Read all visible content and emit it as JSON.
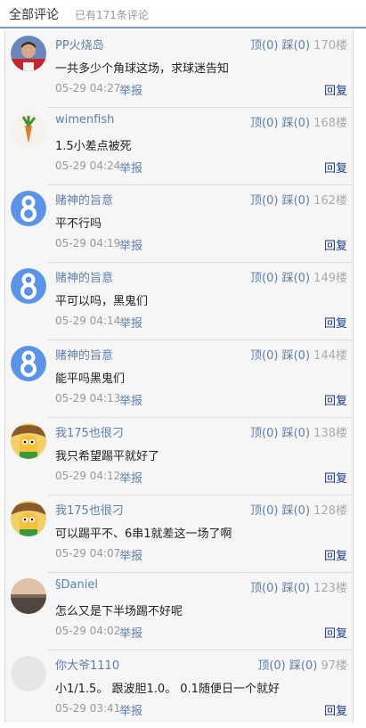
{
  "header": {
    "title": "全部评论",
    "count_text": "已有171条评论"
  },
  "comments": [
    {
      "user": "PP火烧岛",
      "up": "顶(0)",
      "down": "踩(0)",
      "floor": "170楼",
      "text": "一共多少个角球这场，求球迷告知",
      "time": "05-29 04:27",
      "report": "举报",
      "reply": "回复",
      "avatar_icon": "player-photo-avatar-icon"
    },
    {
      "user": "wimenfish",
      "up": "顶(0)",
      "down": "踩(0)",
      "floor": "168楼",
      "text": "1.5小差点被死",
      "time": "05-29 04:24",
      "report": "举报",
      "reply": "回复",
      "avatar_icon": "carrot-avatar-icon"
    },
    {
      "user": "赌神的旨意",
      "up": "顶(0)",
      "down": "踩(0)",
      "floor": "162楼",
      "text": "平不行吗",
      "time": "05-29 04:19",
      "report": "举报",
      "reply": "回复",
      "avatar_icon": "number-8-avatar-icon"
    },
    {
      "user": "赌神的旨意",
      "up": "顶(0)",
      "down": "踩(0)",
      "floor": "149楼",
      "text": "平可以吗，黑鬼们",
      "time": "05-29 04:14",
      "report": "举报",
      "reply": "回复",
      "avatar_icon": "number-8-avatar-icon"
    },
    {
      "user": "赌神的旨意",
      "up": "顶(0)",
      "down": "踩(0)",
      "floor": "144楼",
      "text": "能平吗黑鬼们",
      "time": "05-29 04:13",
      "report": "举报",
      "reply": "回复",
      "avatar_icon": "number-8-avatar-icon"
    },
    {
      "user": "我175也很刁",
      "up": "顶(0)",
      "down": "踩(0)",
      "floor": "138楼",
      "text": "我只希望踢平就好了",
      "time": "05-29 04:12",
      "report": "举报",
      "reply": "回复",
      "avatar_icon": "cartoon-avatar-icon"
    },
    {
      "user": "我175也很刁",
      "up": "顶(0)",
      "down": "踩(0)",
      "floor": "128楼",
      "text": "可以踢平不、6串1就差这一场了啊",
      "time": "05-29 04:07",
      "report": "举报",
      "reply": "回复",
      "avatar_icon": "cartoon-avatar-icon"
    },
    {
      "user": "§Daniel",
      "up": "顶(0)",
      "down": "踩(0)",
      "floor": "123楼",
      "text": "怎么又是下半场踢不好呢",
      "time": "05-29 04:02",
      "report": "举报",
      "reply": "回复",
      "avatar_icon": "sunset-avatar-icon"
    },
    {
      "user": "你大爷1110",
      "up": "顶(0)",
      "down": "踩(0)",
      "floor": "97楼",
      "text": "小1/1.5。 跟波胆1.0。 0.1随便日一个就好",
      "time": "05-29 03:41",
      "report": "举报",
      "reply": "回复",
      "avatar_icon": "default-avatar-icon"
    }
  ]
}
